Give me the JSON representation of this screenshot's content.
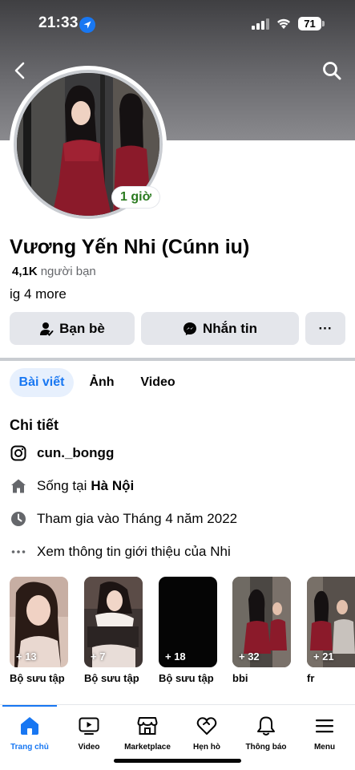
{
  "status_bar": {
    "time": "21:33",
    "battery": "71"
  },
  "profile": {
    "name": "Vương Yến Nhi (Cúnn iu)",
    "friends_count": "4,1K",
    "friends_label": "người bạn",
    "bio": "ig 4 more",
    "story_badge": "1 giờ"
  },
  "actions": {
    "friends": "Bạn bè",
    "message": "Nhắn tin",
    "more": "···"
  },
  "tabs": [
    {
      "label": "Bài viết"
    },
    {
      "label": "Ảnh"
    },
    {
      "label": "Video"
    }
  ],
  "details": {
    "title": "Chi tiết",
    "instagram": "cun._bongg",
    "lives_prefix": "Sống tại",
    "lives_city": "Hà Nội",
    "joined": "Tham gia vào Tháng 4 năm 2022",
    "about_link": "Xem thông tin giới thiệu của Nhi"
  },
  "collections": [
    {
      "label": "Bộ sưu tập",
      "count": "+ 13"
    },
    {
      "label": "Bộ sưu tập",
      "count": "+ 7"
    },
    {
      "label": "Bộ sưu tập",
      "count": "+ 18"
    },
    {
      "label": "bbi",
      "count": "+ 32"
    },
    {
      "label": "fr",
      "count": "+ 21"
    }
  ],
  "bottom_nav": [
    {
      "label": "Trang chủ",
      "icon": "home-icon"
    },
    {
      "label": "Video",
      "icon": "video-icon"
    },
    {
      "label": "Marketplace",
      "icon": "marketplace-icon"
    },
    {
      "label": "Hẹn hò",
      "icon": "dating-icon"
    },
    {
      "label": "Thông báo",
      "icon": "bell-icon"
    },
    {
      "label": "Menu",
      "icon": "menu-icon"
    }
  ],
  "colors": {
    "accent": "#1877f2",
    "button_bg": "#e4e6eb",
    "badge_green": "#2a7a1f"
  }
}
